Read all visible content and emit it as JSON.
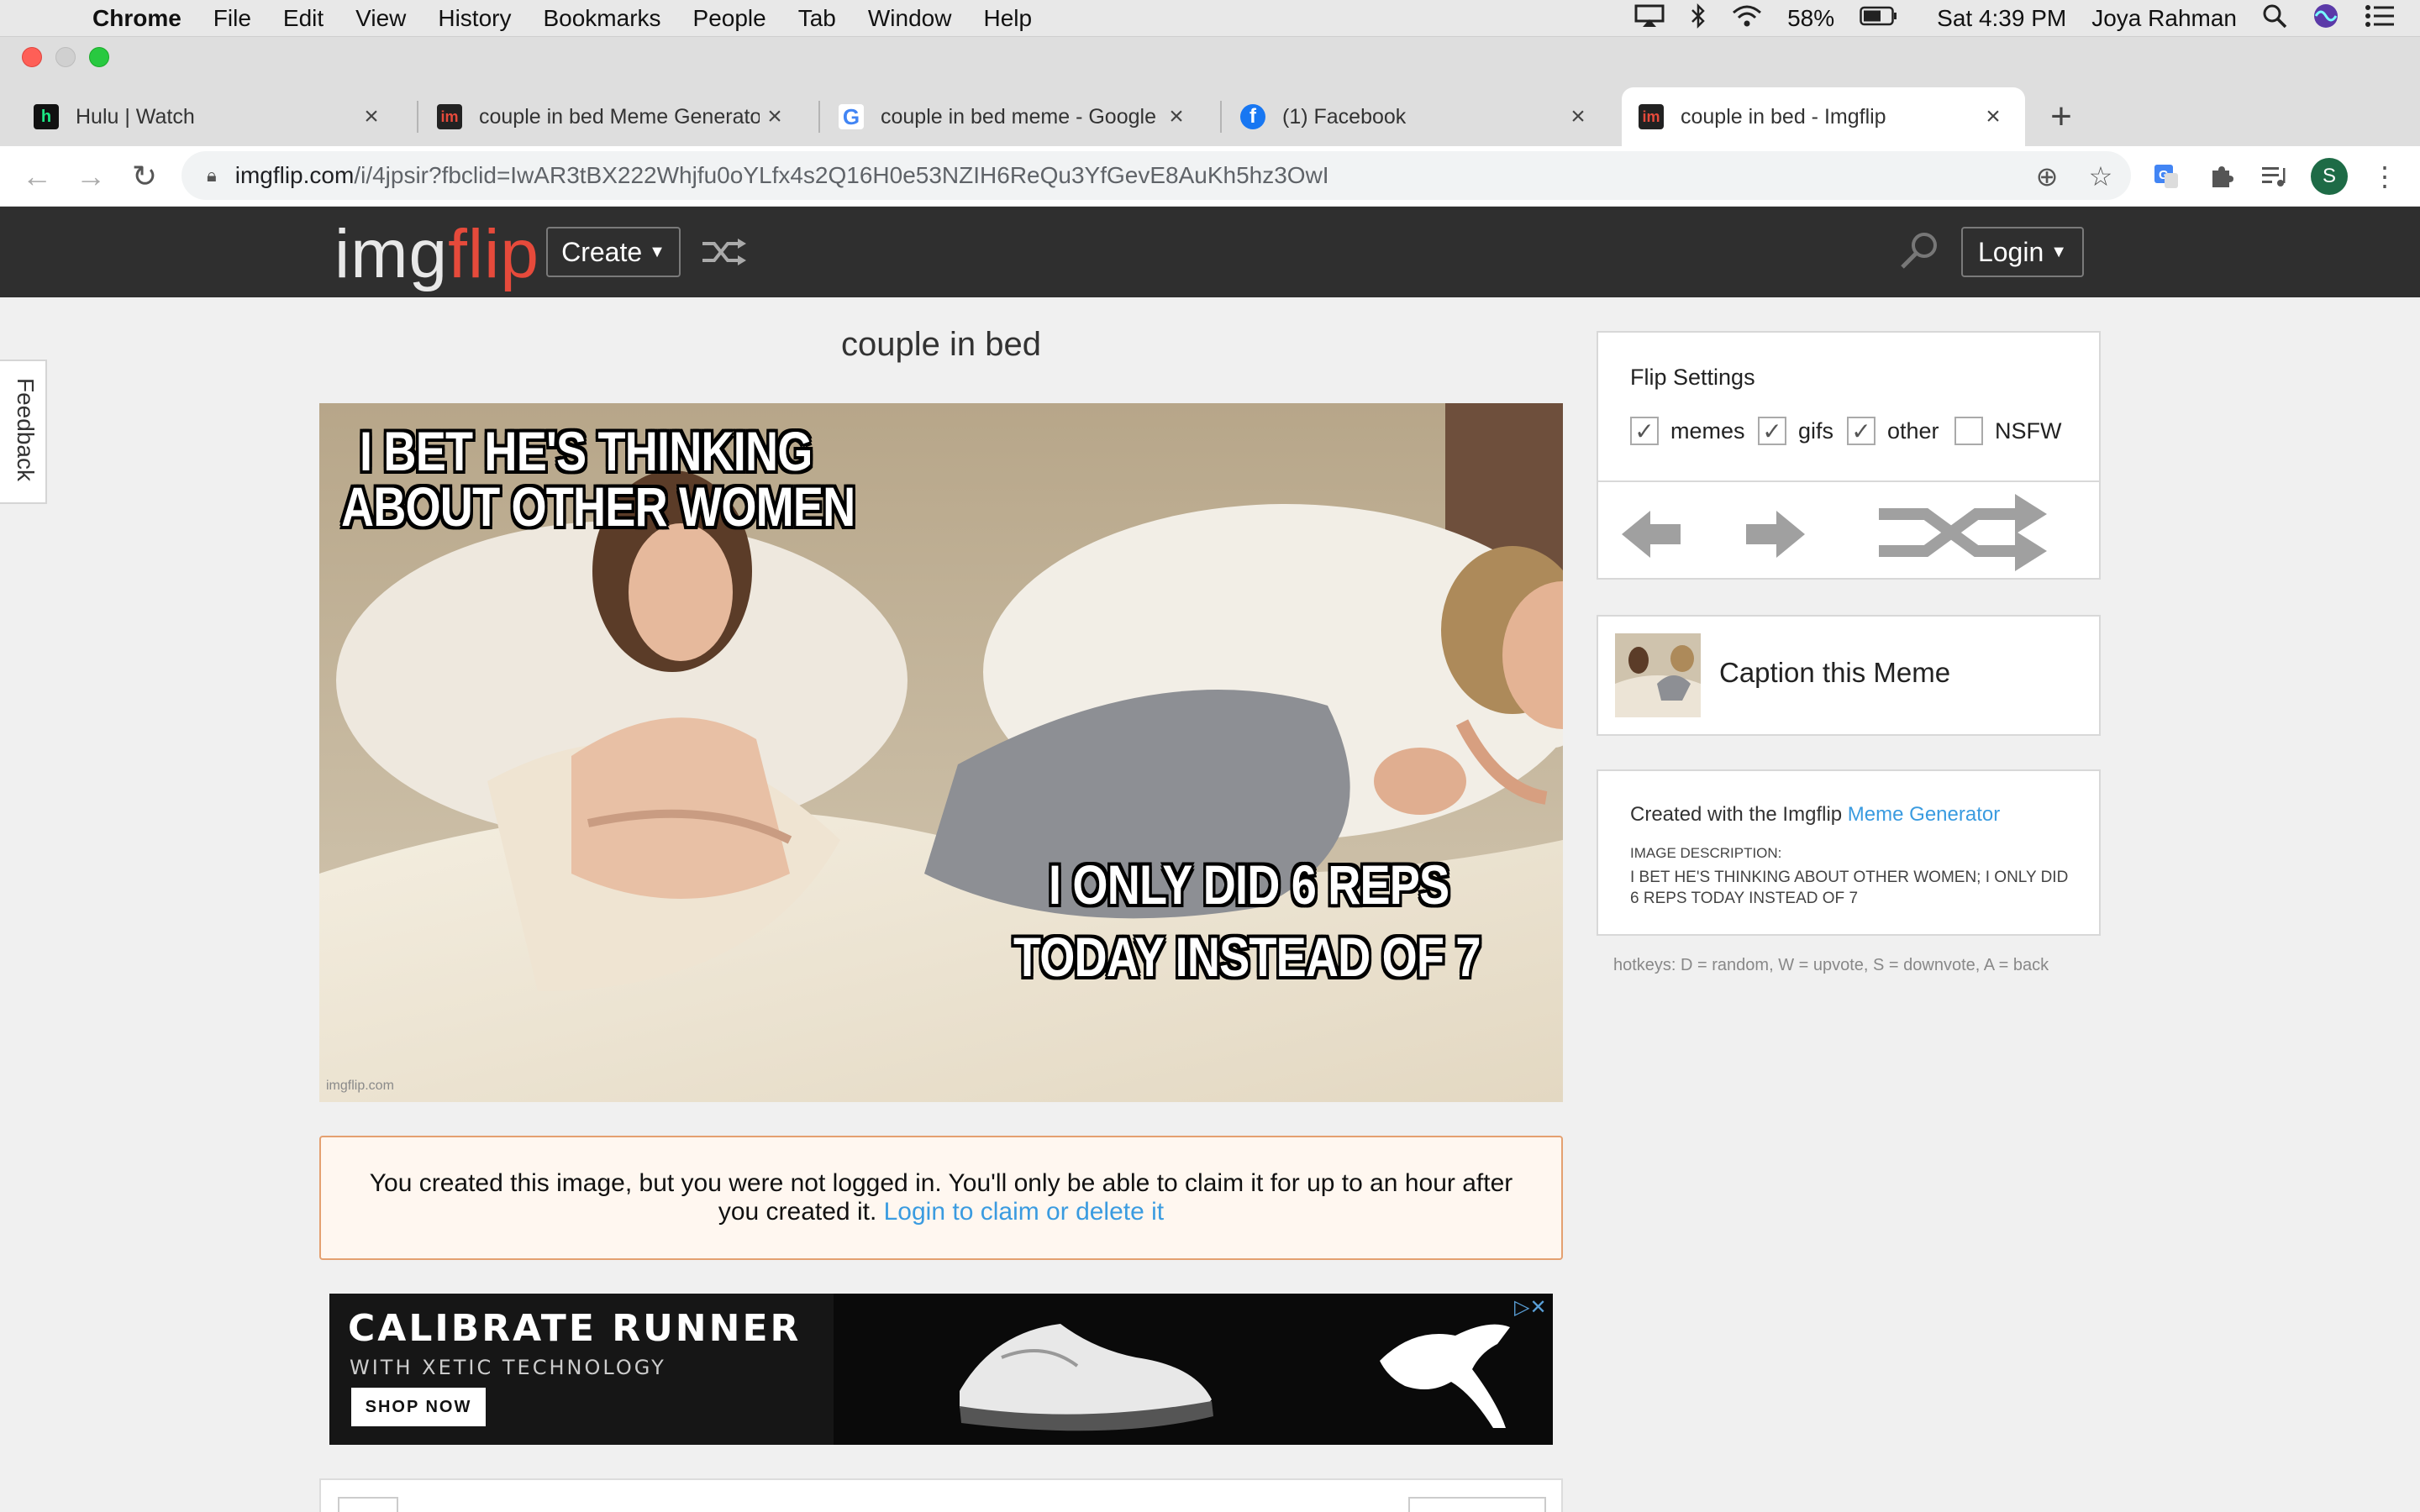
{
  "menubar": {
    "app": "Chrome",
    "items": [
      "File",
      "Edit",
      "View",
      "History",
      "Bookmarks",
      "People",
      "Tab",
      "Window",
      "Help"
    ],
    "battery": "58%",
    "clock": "Sat 4:39 PM",
    "user": "Joya Rahman"
  },
  "tabs": [
    {
      "title": "Hulu | Watch",
      "favicon": "hulu-icon"
    },
    {
      "title": "couple in bed Meme Generator",
      "favicon": "imgflip-icon"
    },
    {
      "title": "couple in bed meme - Google Search",
      "favicon": "google-icon"
    },
    {
      "title": "(1) Facebook",
      "favicon": "facebook-icon"
    },
    {
      "title": "couple in bed - Imgflip",
      "favicon": "imgflip-icon"
    }
  ],
  "omnibox": {
    "host": "imgflip.com",
    "path": "/i/4jpsir?fbclid=IwAR3tBX222Whjfu0oYLfx4s2Q16H0e53NZIH6ReQu3YfGevE8AuKh5hz3OwI"
  },
  "profile_initial": "S",
  "site": {
    "logo_img": "img",
    "logo_flip": "flip",
    "create_label": "Create",
    "login_label": "Login"
  },
  "feedback_label": "Feedback",
  "page_title": "couple in bed",
  "meme": {
    "top_line1": "I BET HE'S THINKING",
    "top_line2": "ABOUT OTHER WOMEN",
    "bottom_line1": "I ONLY DID 6 REPS",
    "bottom_line2": "TODAY INSTEAD OF 7",
    "watermark": "imgflip.com"
  },
  "notice": {
    "text": "You created this image, but you were not logged in. You'll only be able to claim it for up to an hour after you created it.",
    "link": "Login to claim or delete it"
  },
  "ad": {
    "headline": "CALIBRATE RUNNER",
    "subline": "WITH XETIC TECHNOLOGY",
    "cta": "SHOP NOW"
  },
  "flip_settings": {
    "title": "Flip Settings",
    "options": [
      {
        "label": "memes",
        "checked": true
      },
      {
        "label": "gifs",
        "checked": true
      },
      {
        "label": "other",
        "checked": true
      },
      {
        "label": "NSFW",
        "checked": false
      }
    ]
  },
  "caption_label": "Caption this Meme",
  "created_with": {
    "prefix": "Created with the Imgflip",
    "link": "Meme Generator",
    "desc_label": "IMAGE DESCRIPTION:",
    "desc": "I BET HE'S THINKING ABOUT OTHER WOMEN; I ONLY DID 6 REPS TODAY INSTEAD OF 7"
  },
  "hotkeys": "hotkeys: D = random, W = upvote, S = downvote, A = back",
  "colors": {
    "imgflip_red": "#e64a3b",
    "link_blue": "#3a9be0",
    "header_dark": "#2f2f2f"
  }
}
